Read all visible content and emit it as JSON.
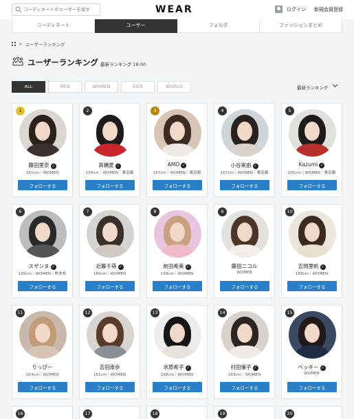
{
  "header": {
    "search_placeholder": "コーディネートやユーザーを探す",
    "logo": "WEAR",
    "login": "ログイン",
    "register": "新規会員登録"
  },
  "tabs": [
    {
      "label": "コーディネート",
      "active": false
    },
    {
      "label": "ユーザー",
      "active": true
    },
    {
      "label": "フォルダ",
      "active": false
    },
    {
      "label": "ファッションまとめ",
      "active": false
    }
  ],
  "breadcrumb": {
    "sep": ">",
    "label": "ユーザーランキング"
  },
  "title": "ユーザーランキング",
  "updated": "最新ランキング 18:00",
  "filters": [
    {
      "label": "ALL",
      "active": true
    },
    {
      "label": "MEN",
      "active": false
    },
    {
      "label": "WOMEN",
      "active": false
    },
    {
      "label": "KIDS",
      "active": false
    },
    {
      "label": "WORLD",
      "active": false
    }
  ],
  "sort": {
    "label": "最新ランキング"
  },
  "follow_label": "フォローする",
  "users": [
    {
      "rank": "1",
      "name": "藤田里奈",
      "verified": true,
      "meta": "161cm｜WOMEN",
      "bg": "#dcd6d0",
      "hair": "#2b211d",
      "body": "#3a3230"
    },
    {
      "rank": "2",
      "name": "高橋愛",
      "verified": true,
      "meta": "154cm｜WOMEN｜東京都",
      "bg": "#ffffff",
      "hair": "#1f1b1b",
      "body": "#c8262b"
    },
    {
      "rank": "3",
      "name": "AMO",
      "verified": true,
      "meta": "167cm｜WOMEN｜東京都",
      "bg": "#d9c5b6",
      "hair": "#3c2b22",
      "body": "#eeeae6"
    },
    {
      "rank": "4",
      "name": "小谷実由",
      "verified": true,
      "meta": "167cm｜WOMEN｜東京都",
      "bg": "#cfd6da",
      "hair": "#2a2220",
      "body": "#d9d3cc"
    },
    {
      "rank": "5",
      "name": "Kazumi",
      "verified": true,
      "meta": "165cm｜WOMEN｜東京都",
      "bg": "#e0e0de",
      "hair": "#1e1a19",
      "body": "#b8302c"
    },
    {
      "rank": "6",
      "name": "スザンヌ",
      "verified": true,
      "meta": "165cm｜WOMEN｜熊本県",
      "bg": "#bdbdbd",
      "hair": "#2a2a2a",
      "body": "#555555"
    },
    {
      "rank": "7",
      "name": "近藤千尋",
      "verified": true,
      "meta": "160cm｜WOMEN",
      "bg": "#d3d5d2",
      "hair": "#3a302b",
      "body": "#cfc9c2"
    },
    {
      "rank": "8",
      "name": "前田希美",
      "verified": true,
      "meta": "158cm｜WOMEN",
      "bg": "#e9c6df",
      "hair": "#c9a182",
      "body": "#f0b9c8"
    },
    {
      "rank": "9",
      "name": "藤田ニコル",
      "verified": false,
      "meta": "WOMEN",
      "bg": "#e4e2df",
      "hair": "#4a3528",
      "body": "#f2efea"
    },
    {
      "rank": "10",
      "name": "吉岡里帆",
      "verified": true,
      "meta": "158cm｜WOMEN",
      "bg": "#ece6dc",
      "hair": "#3b2a21",
      "body": "#e9dfcf"
    },
    {
      "rank": "11",
      "name": "りっぴー",
      "verified": false,
      "meta": "154cm｜WOMEN",
      "bg": "#c9b9ad",
      "hair": "#c29b78",
      "body": "#d7c4b4"
    },
    {
      "rank": "12",
      "name": "吉田南歩",
      "verified": false,
      "meta": "161cm｜WOMEN",
      "bg": "#d8d4cf",
      "hair": "#5a3a28",
      "body": "#8b8f96"
    },
    {
      "rank": "13",
      "name": "水原希子",
      "verified": true,
      "meta": "168cm｜WOMEN",
      "bg": "#ededed",
      "hair": "#161616",
      "body": "#e7e2dc"
    },
    {
      "rank": "14",
      "name": "村田倫子",
      "verified": true,
      "meta": "163cm｜WOMEN",
      "bg": "#d7d2cc",
      "hair": "#2c2422",
      "body": "#eeeae5"
    },
    {
      "rank": "15",
      "name": "ベッキー",
      "verified": true,
      "meta": "WOMEN",
      "bg": "#3a4a63",
      "hair": "#211a18",
      "body": "#1f2c44"
    }
  ],
  "partial_ranks": [
    "16",
    "17",
    "18",
    "19",
    "20"
  ]
}
